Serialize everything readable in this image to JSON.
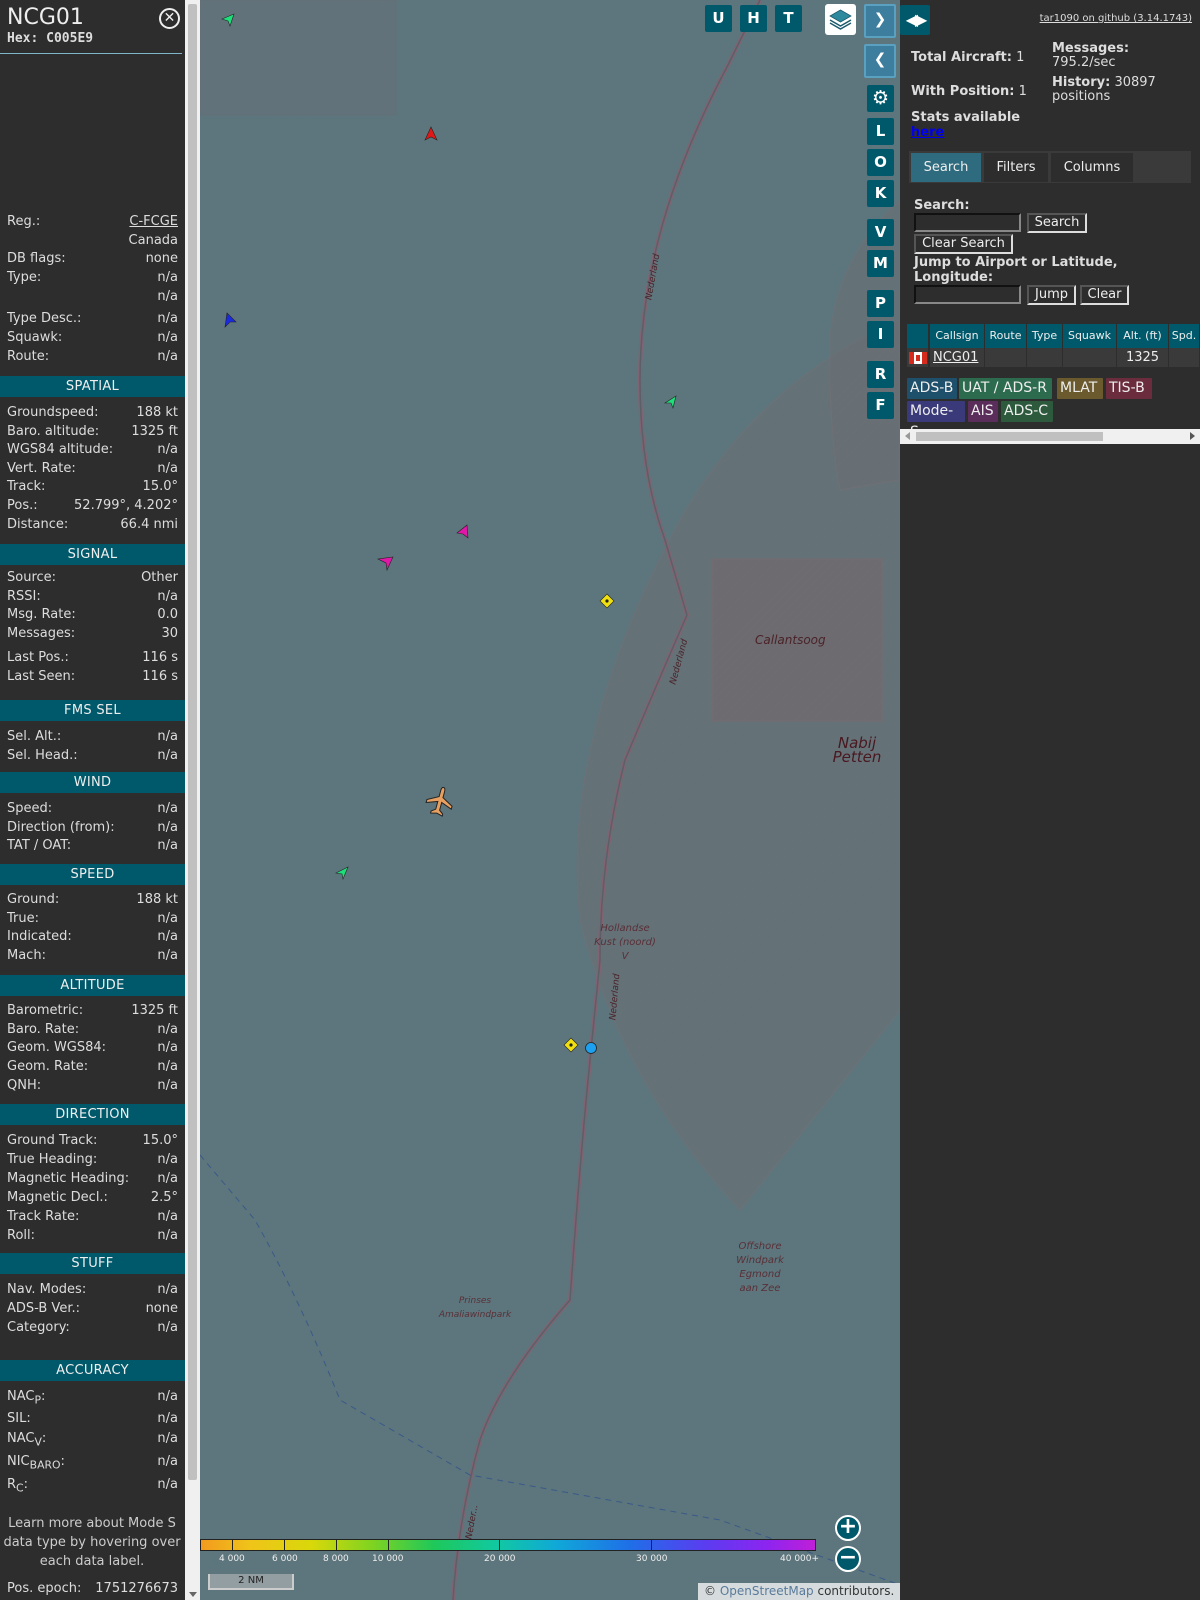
{
  "info": {
    "callsign": "NCG01",
    "hex_label": "Hex:",
    "hex": "C005E9",
    "close_glyph": "✕",
    "identity": {
      "reg_label": "Reg.:",
      "reg": "C-FCGE",
      "country": "Canada",
      "db_flags_label": "DB flags:",
      "db_flags": "none",
      "type_label": "Type:",
      "type": "n/a",
      "type2": "n/a",
      "type_desc_label": "Type Desc.:",
      "type_desc": "n/a",
      "squawk_label": "Squawk:",
      "squawk": "n/a",
      "route_label": "Route:",
      "route": "n/a"
    },
    "spatial": {
      "title": "SPATIAL",
      "rows": [
        {
          "label": "Groundspeed:",
          "value": "188 kt"
        },
        {
          "label": "Baro. altitude:",
          "value": "1325 ft"
        },
        {
          "label": "WGS84 altitude:",
          "value": "n/a"
        },
        {
          "label": "Vert. Rate:",
          "value": "n/a"
        },
        {
          "label": "Track:",
          "value": "15.0°"
        },
        {
          "label": "Pos.:",
          "value": "52.799°, 4.202°"
        },
        {
          "label": "Distance:",
          "value": "66.4 nmi"
        }
      ]
    },
    "signal": {
      "title": "SIGNAL",
      "rows": [
        {
          "label": "Source:",
          "value": "Other"
        },
        {
          "label": "RSSI:",
          "value": "n/a"
        },
        {
          "label": "Msg. Rate:",
          "value": "0.0"
        },
        {
          "label": "Messages:",
          "value": "30"
        },
        {
          "label": "Last Pos.:",
          "value": "116 s"
        },
        {
          "label": "Last Seen:",
          "value": "116 s"
        }
      ]
    },
    "fms": {
      "title": "FMS SEL",
      "rows": [
        {
          "label": "Sel. Alt.:",
          "value": "n/a"
        },
        {
          "label": "Sel. Head.:",
          "value": "n/a"
        }
      ]
    },
    "wind": {
      "title": "WIND",
      "rows": [
        {
          "label": "Speed:",
          "value": "n/a"
        },
        {
          "label": "Direction (from):",
          "value": "n/a"
        },
        {
          "label": "TAT / OAT:",
          "value": "n/a"
        }
      ]
    },
    "speed": {
      "title": "SPEED",
      "rows": [
        {
          "label": "Ground:",
          "value": "188 kt"
        },
        {
          "label": "True:",
          "value": "n/a"
        },
        {
          "label": "Indicated:",
          "value": "n/a"
        },
        {
          "label": "Mach:",
          "value": "n/a"
        }
      ]
    },
    "altitude": {
      "title": "ALTITUDE",
      "rows": [
        {
          "label": "Barometric:",
          "value": "1325 ft"
        },
        {
          "label": "Baro. Rate:",
          "value": "n/a"
        },
        {
          "label": "Geom. WGS84:",
          "value": "n/a"
        },
        {
          "label": "Geom. Rate:",
          "value": "n/a"
        },
        {
          "label": "QNH:",
          "value": "n/a"
        }
      ]
    },
    "direction": {
      "title": "DIRECTION",
      "rows": [
        {
          "label": "Ground Track:",
          "value": "15.0°"
        },
        {
          "label": "True Heading:",
          "value": "n/a"
        },
        {
          "label": "Magnetic Heading:",
          "value": "n/a"
        },
        {
          "label": "Magnetic Decl.:",
          "value": "2.5°"
        },
        {
          "label": "Track Rate:",
          "value": "n/a"
        },
        {
          "label": "Roll:",
          "value": "n/a"
        }
      ]
    },
    "stuff": {
      "title": "STUFF",
      "rows": [
        {
          "label": "Nav. Modes:",
          "value": "n/a"
        },
        {
          "label": "ADS-B Ver.:",
          "value": "none"
        },
        {
          "label": "Category:",
          "value": "n/a"
        }
      ]
    },
    "accuracy": {
      "title": "ACCURACY",
      "nacp_label": "NAC",
      "nacp_sub": "P",
      "nacp": "n/a",
      "sil_label": "SIL:",
      "sil": "n/a",
      "nacv_label": "NAC",
      "nacv_sub": "V",
      "nacv": "n/a",
      "nicbaro_label": "NIC",
      "nicbaro_sub": "BARO",
      "nicbaro": "n/a",
      "rc_label": "R",
      "rc_sub": "C",
      "rc": "n/a"
    },
    "footer_note": "Learn more about Mode S data type by hovering over each data label.",
    "pos_epoch_label": "Pos. epoch:",
    "pos_epoch": "1751276673"
  },
  "map": {
    "top_buttons": [
      "U",
      "H",
      "T"
    ],
    "side_buttons": [
      "L",
      "O",
      "K",
      "V",
      "M",
      "P",
      "I",
      "R",
      "F"
    ],
    "forward_glyph": "❯",
    "back_glyph": "❮",
    "settings_glyph": "⚙",
    "zoom_in": "+",
    "zoom_out": "−",
    "labels": {
      "nederland": "Nederland",
      "callantsoog": "Callantsoog",
      "nabij_petten": "Nabij Petten",
      "hollandse_kust": "Hollandse Kust (noord) V",
      "offshore": "Offshore Windpark Egmond aan Zee",
      "prinses": "Prinses Amaliawindpark",
      "nederland_bottom": "Neder..."
    },
    "altitude_legend": [
      "4 000",
      "6 000",
      "8 000",
      "10 000",
      "20 000",
      "30 000",
      "40 000+"
    ],
    "scale": "2 NM",
    "attribution_prefix": "© ",
    "attribution_osm": "OpenStreetMap",
    "attribution_suffix": " contributors."
  },
  "right": {
    "toggle_glyph": "◀▶",
    "version_link": "tar1090 on github (3.14.1743)",
    "total_aircraft_label": "Total Aircraft:",
    "total_aircraft": "1",
    "with_position_label": "With Position:",
    "with_position": "1",
    "messages_label": "Messages:",
    "messages": "795.2/sec",
    "history_label": "History:",
    "history": "30897 positions",
    "stats_label": "Stats available",
    "stats_link": "here",
    "tabs": [
      "Search",
      "Filters",
      "Columns"
    ],
    "search_label": "Search:",
    "search_value": "",
    "search_button": "Search",
    "clear_search_button": "Clear Search",
    "jump_label": "Jump to Airport or Latitude, Longitude:",
    "jump_value": "",
    "jump_button": "Jump",
    "clear_button": "Clear",
    "table": {
      "columns": [
        "Callsign",
        "Route",
        "Type",
        "Squawk",
        "Alt. (ft)",
        "Spd."
      ],
      "rows": [
        {
          "callsign": "NCG01",
          "route": "",
          "type": "",
          "squawk": "",
          "alt": "1325",
          "spd": ""
        }
      ]
    },
    "sources": [
      {
        "label": "ADS-B",
        "color": "#1e4f6b"
      },
      {
        "label": "UAT / ADS-R",
        "color": "#2d6b4f"
      },
      {
        "label": "MLAT",
        "color": "#6b5a2d"
      },
      {
        "label": "TIS-B",
        "color": "#6b2d3d"
      },
      {
        "label": "Mode-S",
        "color": "#3a3a7a"
      },
      {
        "label": "AIS",
        "color": "#5a2d5a"
      },
      {
        "label": "ADS-C",
        "color": "#2d5a3d"
      }
    ]
  },
  "colors": {
    "accent": "#00596b",
    "map_water": "#5d757c",
    "panel_bg": "#2d2d2d",
    "selected_aircraft": "#e8a060"
  }
}
